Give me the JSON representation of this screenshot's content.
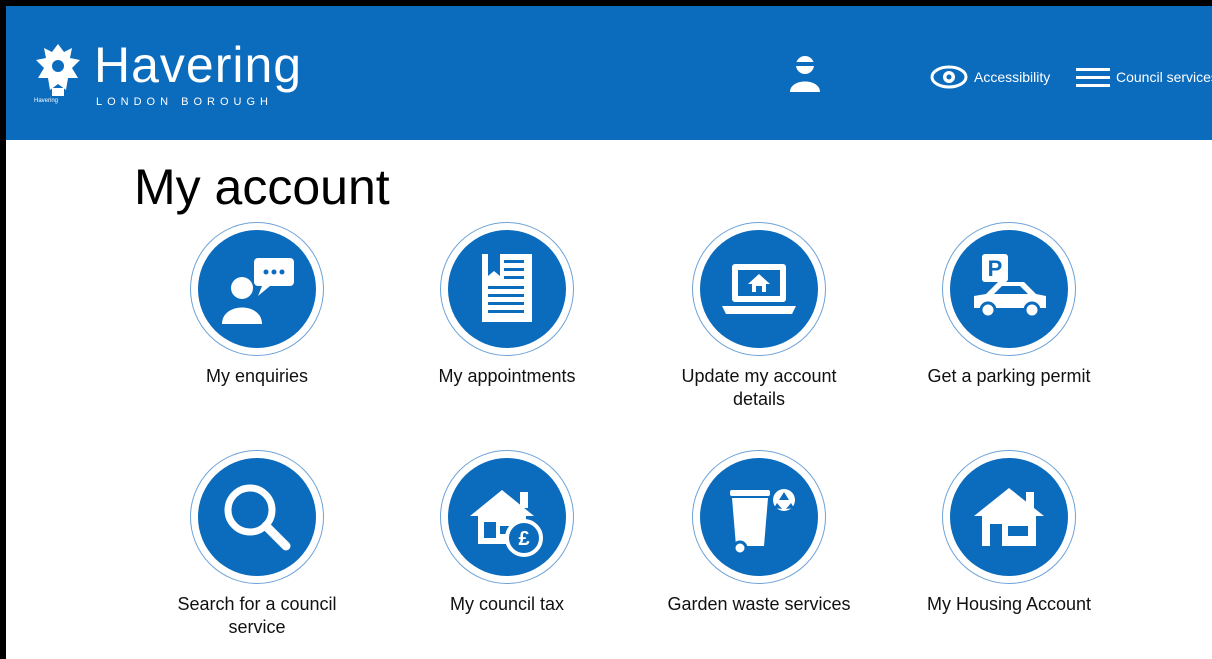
{
  "header": {
    "brand": "Havering",
    "sub": "LONDON BOROUGH",
    "crest_text": "Havering",
    "accessibility_label": "Accessibility",
    "menu_label": "Council services",
    "background": "#0b6bbd"
  },
  "page": {
    "title": "My account"
  },
  "tiles": [
    {
      "label": "My enquiries",
      "icon": "enquiries-icon"
    },
    {
      "label": "My appointments",
      "icon": "appointments-icon"
    },
    {
      "label": "Update my account details",
      "icon": "update-account-icon"
    },
    {
      "label": "Get a parking permit",
      "icon": "parking-permit-icon"
    },
    {
      "label": "Search for a council service",
      "icon": "search-icon"
    },
    {
      "label": "My council tax",
      "icon": "council-tax-icon"
    },
    {
      "label": "Garden waste services",
      "icon": "garden-waste-icon"
    },
    {
      "label": "My Housing Account",
      "icon": "housing-icon"
    }
  ]
}
